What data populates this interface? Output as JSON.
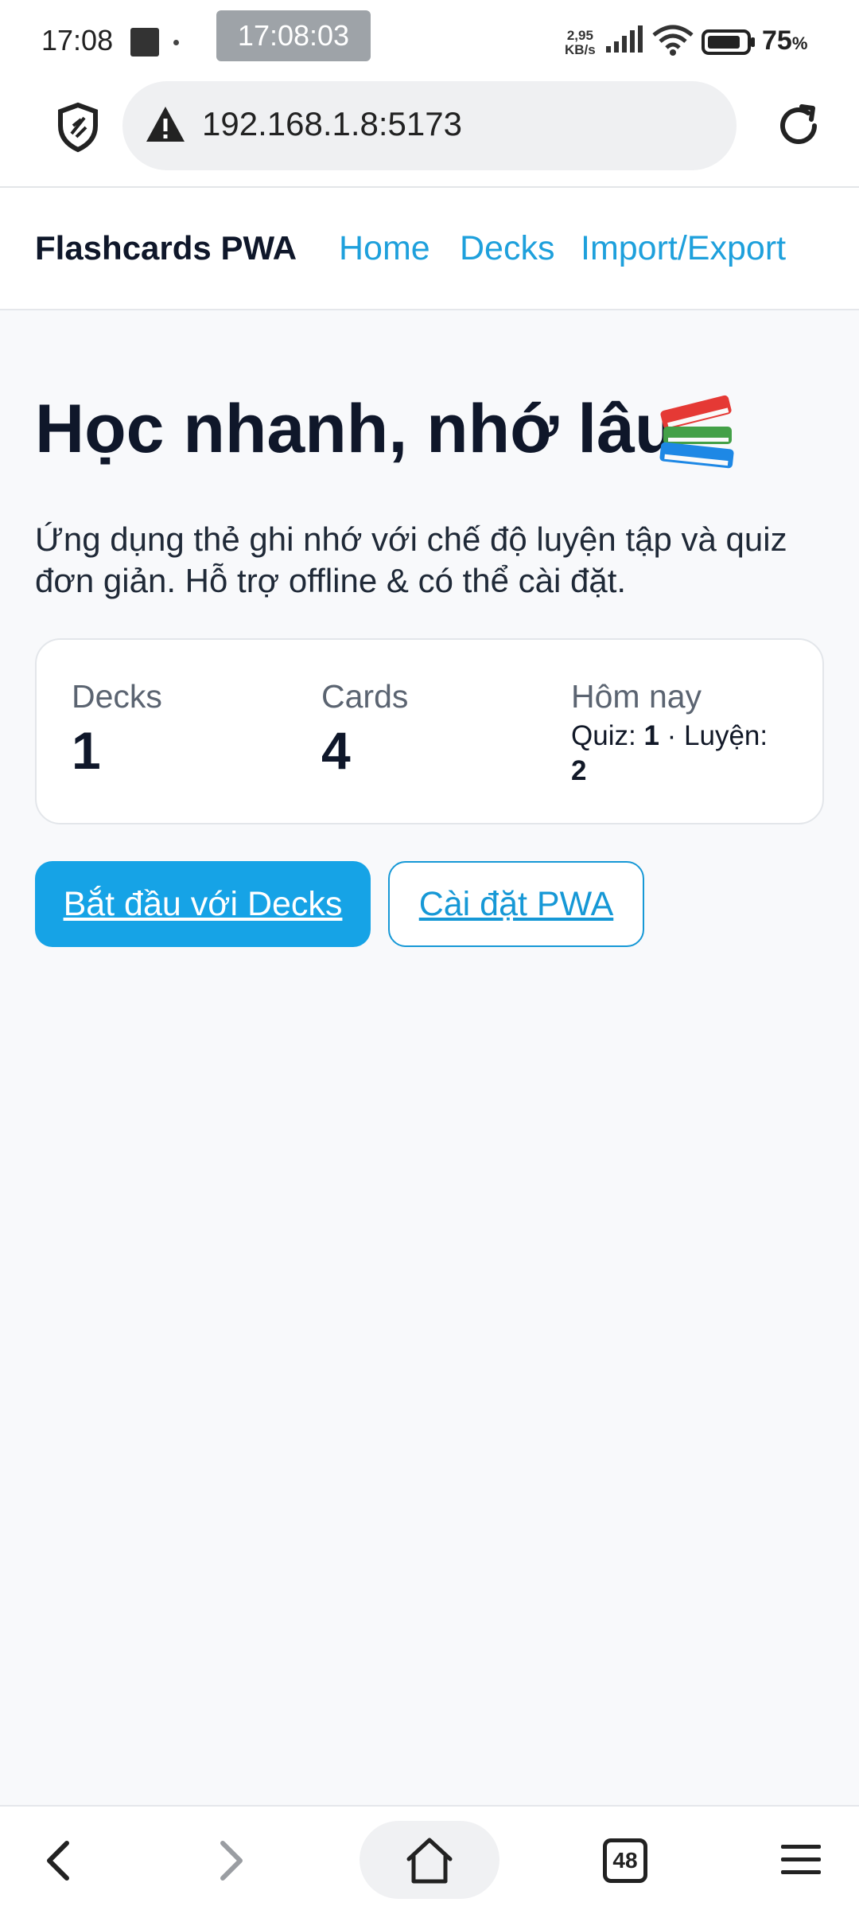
{
  "status_bar": {
    "time": "17:08",
    "screen_recorder_time": "17:08:03",
    "net_speed_value": "2,95",
    "net_speed_unit": "KB/s",
    "battery_value": "75",
    "battery_unit": "%"
  },
  "browser": {
    "url": "192.168.1.8:5173",
    "tab_count": "48"
  },
  "nav": {
    "brand": "Flashcards PWA",
    "links": [
      "Home",
      "Decks",
      "Import/Export"
    ]
  },
  "hero": {
    "title": "Học nhanh, nhớ lâu",
    "emoji": "📚",
    "description": "Ứng dụng thẻ ghi nhớ với chế độ luyện tập và quiz đơn giản. Hỗ trợ offline & có thể cài đặt."
  },
  "stats": {
    "decks_label": "Decks",
    "decks_value": "1",
    "cards_label": "Cards",
    "cards_value": "4",
    "today_label": "Hôm nay",
    "quiz_label": "Quiz:",
    "quiz_value": "1",
    "separator": "·",
    "practice_label": "Luyện:",
    "practice_value": "2"
  },
  "actions": {
    "primary": "Bắt đầu với Decks",
    "secondary": "Cài đặt PWA"
  },
  "colors": {
    "accent": "#16a3e6",
    "link": "#1ea0dc",
    "text": "#0f172a",
    "background": "#f8f9fb"
  },
  "icons": [
    "shield-icon",
    "warning-icon",
    "reload-icon",
    "back-icon",
    "forward-icon",
    "home-icon",
    "tabs-icon",
    "menu-icon",
    "books-emoji"
  ]
}
